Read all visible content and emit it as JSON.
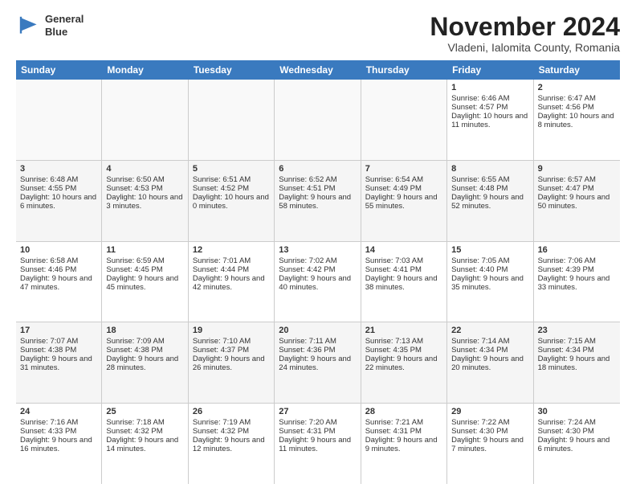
{
  "header": {
    "logo_line1": "General",
    "logo_line2": "Blue",
    "month_title": "November 2024",
    "location": "Vladeni, Ialomita County, Romania"
  },
  "days_of_week": [
    "Sunday",
    "Monday",
    "Tuesday",
    "Wednesday",
    "Thursday",
    "Friday",
    "Saturday"
  ],
  "rows": [
    {
      "cells": [
        {
          "day": "",
          "info": "",
          "empty": true
        },
        {
          "day": "",
          "info": "",
          "empty": true
        },
        {
          "day": "",
          "info": "",
          "empty": true
        },
        {
          "day": "",
          "info": "",
          "empty": true
        },
        {
          "day": "",
          "info": "",
          "empty": true
        },
        {
          "day": "1",
          "info": "Sunrise: 6:46 AM\nSunset: 4:57 PM\nDaylight: 10 hours and 11 minutes."
        },
        {
          "day": "2",
          "info": "Sunrise: 6:47 AM\nSunset: 4:56 PM\nDaylight: 10 hours and 8 minutes."
        }
      ]
    },
    {
      "cells": [
        {
          "day": "3",
          "info": "Sunrise: 6:48 AM\nSunset: 4:55 PM\nDaylight: 10 hours and 6 minutes."
        },
        {
          "day": "4",
          "info": "Sunrise: 6:50 AM\nSunset: 4:53 PM\nDaylight: 10 hours and 3 minutes."
        },
        {
          "day": "5",
          "info": "Sunrise: 6:51 AM\nSunset: 4:52 PM\nDaylight: 10 hours and 0 minutes."
        },
        {
          "day": "6",
          "info": "Sunrise: 6:52 AM\nSunset: 4:51 PM\nDaylight: 9 hours and 58 minutes."
        },
        {
          "day": "7",
          "info": "Sunrise: 6:54 AM\nSunset: 4:49 PM\nDaylight: 9 hours and 55 minutes."
        },
        {
          "day": "8",
          "info": "Sunrise: 6:55 AM\nSunset: 4:48 PM\nDaylight: 9 hours and 52 minutes."
        },
        {
          "day": "9",
          "info": "Sunrise: 6:57 AM\nSunset: 4:47 PM\nDaylight: 9 hours and 50 minutes."
        }
      ]
    },
    {
      "cells": [
        {
          "day": "10",
          "info": "Sunrise: 6:58 AM\nSunset: 4:46 PM\nDaylight: 9 hours and 47 minutes."
        },
        {
          "day": "11",
          "info": "Sunrise: 6:59 AM\nSunset: 4:45 PM\nDaylight: 9 hours and 45 minutes."
        },
        {
          "day": "12",
          "info": "Sunrise: 7:01 AM\nSunset: 4:44 PM\nDaylight: 9 hours and 42 minutes."
        },
        {
          "day": "13",
          "info": "Sunrise: 7:02 AM\nSunset: 4:42 PM\nDaylight: 9 hours and 40 minutes."
        },
        {
          "day": "14",
          "info": "Sunrise: 7:03 AM\nSunset: 4:41 PM\nDaylight: 9 hours and 38 minutes."
        },
        {
          "day": "15",
          "info": "Sunrise: 7:05 AM\nSunset: 4:40 PM\nDaylight: 9 hours and 35 minutes."
        },
        {
          "day": "16",
          "info": "Sunrise: 7:06 AM\nSunset: 4:39 PM\nDaylight: 9 hours and 33 minutes."
        }
      ]
    },
    {
      "cells": [
        {
          "day": "17",
          "info": "Sunrise: 7:07 AM\nSunset: 4:38 PM\nDaylight: 9 hours and 31 minutes."
        },
        {
          "day": "18",
          "info": "Sunrise: 7:09 AM\nSunset: 4:38 PM\nDaylight: 9 hours and 28 minutes."
        },
        {
          "day": "19",
          "info": "Sunrise: 7:10 AM\nSunset: 4:37 PM\nDaylight: 9 hours and 26 minutes."
        },
        {
          "day": "20",
          "info": "Sunrise: 7:11 AM\nSunset: 4:36 PM\nDaylight: 9 hours and 24 minutes."
        },
        {
          "day": "21",
          "info": "Sunrise: 7:13 AM\nSunset: 4:35 PM\nDaylight: 9 hours and 22 minutes."
        },
        {
          "day": "22",
          "info": "Sunrise: 7:14 AM\nSunset: 4:34 PM\nDaylight: 9 hours and 20 minutes."
        },
        {
          "day": "23",
          "info": "Sunrise: 7:15 AM\nSunset: 4:34 PM\nDaylight: 9 hours and 18 minutes."
        }
      ]
    },
    {
      "cells": [
        {
          "day": "24",
          "info": "Sunrise: 7:16 AM\nSunset: 4:33 PM\nDaylight: 9 hours and 16 minutes."
        },
        {
          "day": "25",
          "info": "Sunrise: 7:18 AM\nSunset: 4:32 PM\nDaylight: 9 hours and 14 minutes."
        },
        {
          "day": "26",
          "info": "Sunrise: 7:19 AM\nSunset: 4:32 PM\nDaylight: 9 hours and 12 minutes."
        },
        {
          "day": "27",
          "info": "Sunrise: 7:20 AM\nSunset: 4:31 PM\nDaylight: 9 hours and 11 minutes."
        },
        {
          "day": "28",
          "info": "Sunrise: 7:21 AM\nSunset: 4:31 PM\nDaylight: 9 hours and 9 minutes."
        },
        {
          "day": "29",
          "info": "Sunrise: 7:22 AM\nSunset: 4:30 PM\nDaylight: 9 hours and 7 minutes."
        },
        {
          "day": "30",
          "info": "Sunrise: 7:24 AM\nSunset: 4:30 PM\nDaylight: 9 hours and 6 minutes."
        }
      ]
    }
  ]
}
